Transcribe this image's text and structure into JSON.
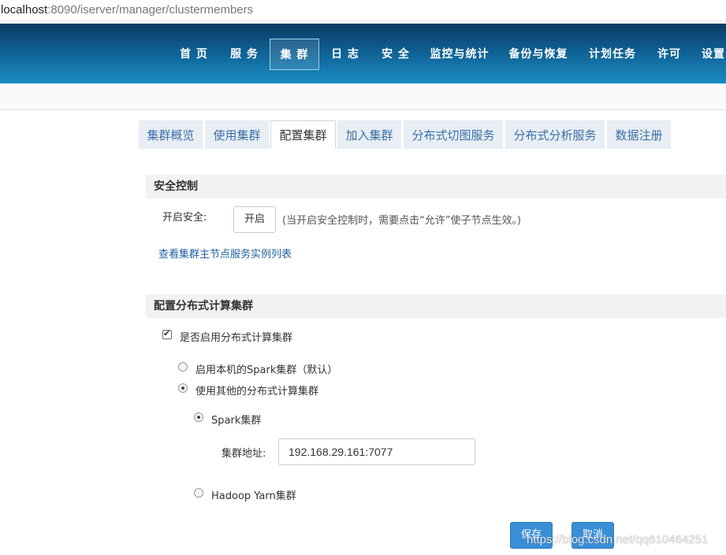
{
  "browser": {
    "url_host": "localhost",
    "url_rest": ":8090/iserver/manager/clustermembers"
  },
  "navbar": {
    "items": [
      {
        "label": "首 页"
      },
      {
        "label": "服 务"
      },
      {
        "label": "集 群"
      },
      {
        "label": "日 志"
      },
      {
        "label": "安 全"
      },
      {
        "label": "监控与统计"
      },
      {
        "label": "备份与恢复"
      },
      {
        "label": "计划任务"
      },
      {
        "label": "许可"
      },
      {
        "label": "设置"
      }
    ],
    "active_index": 2
  },
  "tabs": {
    "items": [
      {
        "label": "集群概览"
      },
      {
        "label": "使用集群"
      },
      {
        "label": "配置集群"
      },
      {
        "label": "加入集群"
      },
      {
        "label": "分布式切图服务"
      },
      {
        "label": "分布式分析服务"
      },
      {
        "label": "数据注册"
      }
    ],
    "active_index": 2
  },
  "security": {
    "title": "安全控制",
    "enable_label": "开启安全:",
    "open_button": "开启",
    "hint": "(当开启安全控制时，需要点击“允许”使子节点生效。)",
    "link": "查看集群主节点服务实例列表"
  },
  "distributed": {
    "title": "配置分布式计算集群",
    "enable_checkbox_label": "是否启用分布式计算集群",
    "enable_checked": true,
    "option_local": "启用本机的Spark集群（默认）",
    "option_other": "使用其他的分布式计算集群",
    "selected_option": "other",
    "spark_label": "Spark集群",
    "spark_selected": true,
    "address_label": "集群地址:",
    "address_value": "192.168.29.161:7077",
    "hadoop_label": "Hadoop Yarn集群"
  },
  "actions": {
    "save_label": "保存",
    "cancel_label": "取消"
  },
  "watermark": "https://blog.csdn.net/qq610464251",
  "colors": {
    "nav_top": "#0b3a63",
    "nav_bottom": "#1a8cc4",
    "tab_bg": "#e8eef4",
    "tab_text": "#3a6fa8",
    "link": "#1f5f9e",
    "primary_button": "#3a8ed6"
  }
}
